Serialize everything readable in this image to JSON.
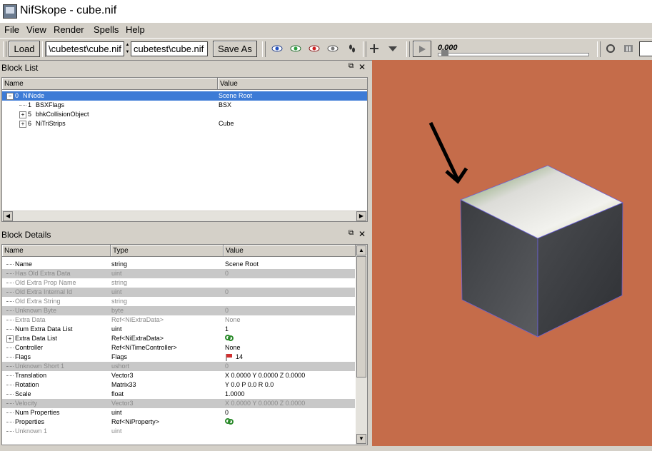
{
  "window": {
    "title": "NifSkope - cube.nif"
  },
  "menu": [
    "File",
    "View",
    "Render",
    "Spells",
    "Help"
  ],
  "toolbar": {
    "load_label": "Load",
    "load_path": "\\cubetest\\cube.nif",
    "save_path": "cubetest\\cube.nif",
    "save_as_label": "Save As",
    "time_value": "0.000"
  },
  "block_list": {
    "title": "Block List",
    "columns": [
      "Name",
      "Value"
    ],
    "rows": [
      {
        "index": "0",
        "name": "NiNode",
        "value": "Scene Root"
      },
      {
        "index": "1",
        "name": "BSXFlags",
        "value": "BSX"
      },
      {
        "index": "5",
        "name": "bhkCollisionObject",
        "value": ""
      },
      {
        "index": "6",
        "name": "NiTriStrips",
        "value": "Cube"
      }
    ]
  },
  "block_details": {
    "title": "Block Details",
    "columns": [
      "Name",
      "Type",
      "Value"
    ],
    "rows": [
      {
        "name": "Name",
        "type": "string",
        "value": "Scene Root"
      },
      {
        "name": "Has Old Extra Data",
        "type": "uint",
        "value": "0"
      },
      {
        "name": "Old Extra Prop Name",
        "type": "string",
        "value": ""
      },
      {
        "name": "Old Extra Internal Id",
        "type": "uint",
        "value": "0"
      },
      {
        "name": "Old Extra String",
        "type": "string",
        "value": ""
      },
      {
        "name": "Unknown Byte",
        "type": "byte",
        "value": "0"
      },
      {
        "name": "Extra Data",
        "type": "Ref<NiExtraData>",
        "value": "None"
      },
      {
        "name": "Num Extra Data List",
        "type": "uint",
        "value": "1"
      },
      {
        "name": "Extra Data List",
        "type": "Ref<NiExtraData>",
        "value": ""
      },
      {
        "name": "Controller",
        "type": "Ref<NiTimeController>",
        "value": "None"
      },
      {
        "name": "Flags",
        "type": "Flags",
        "value": "14"
      },
      {
        "name": "Unknown Short 1",
        "type": "ushort",
        "value": "0"
      },
      {
        "name": "Translation",
        "type": "Vector3",
        "value": "X 0.0000 Y 0.0000 Z 0.0000"
      },
      {
        "name": "Rotation",
        "type": "Matrix33",
        "value": "Y 0.0 P 0.0 R 0.0"
      },
      {
        "name": "Scale",
        "type": "float",
        "value": "1.0000"
      },
      {
        "name": "Velocity",
        "type": "Vector3",
        "value": "X 0.0000 Y 0.0000 Z 0.0000"
      },
      {
        "name": "Num Properties",
        "type": "uint",
        "value": "0"
      },
      {
        "name": "Properties",
        "type": "Ref<NiProperty>",
        "value": ""
      },
      {
        "name": "Unknown 1",
        "type": "uint",
        "value": ""
      }
    ]
  },
  "colors": {
    "viewport_bg": "#c56c4a",
    "selection": "#3d7bd6",
    "disabled_row": "#c8c8c8"
  }
}
